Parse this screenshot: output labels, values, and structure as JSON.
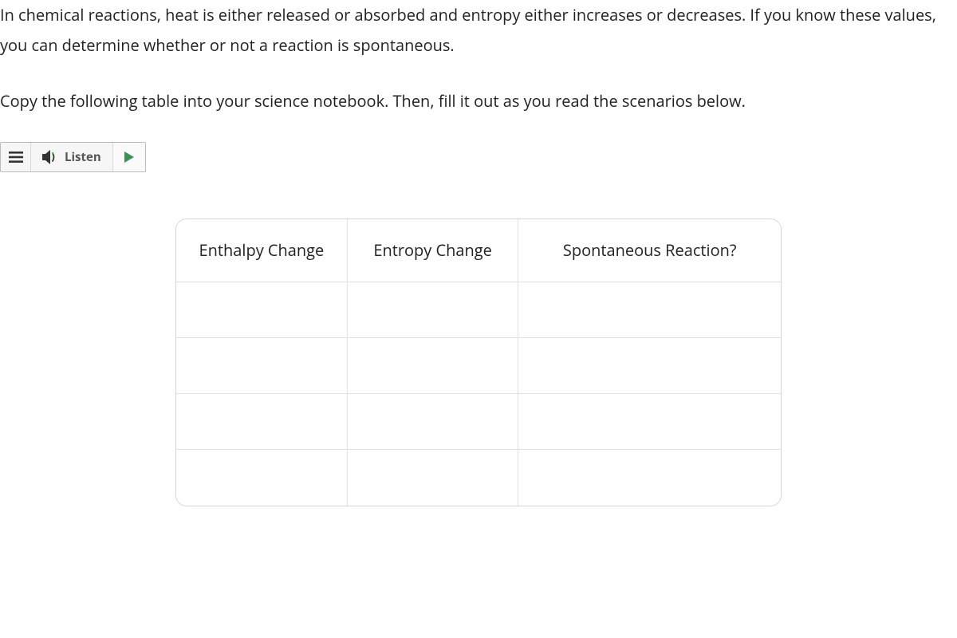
{
  "paragraphs": {
    "intro": "In chemical reactions, heat is either released or absorbed and entropy either increases or decreases. If you know these values, you can determine whether or not a reaction is spontaneous.",
    "instruction": "Copy the following table into your science notebook. Then, fill it out as you read the scenarios below."
  },
  "listen": {
    "label": "Listen"
  },
  "table": {
    "headers": [
      "Enthalpy Change",
      "Entropy Change",
      "Spontaneous Reaction?"
    ],
    "rows": [
      [
        "",
        "",
        ""
      ],
      [
        "",
        "",
        ""
      ],
      [
        "",
        "",
        ""
      ],
      [
        "",
        "",
        ""
      ]
    ]
  }
}
